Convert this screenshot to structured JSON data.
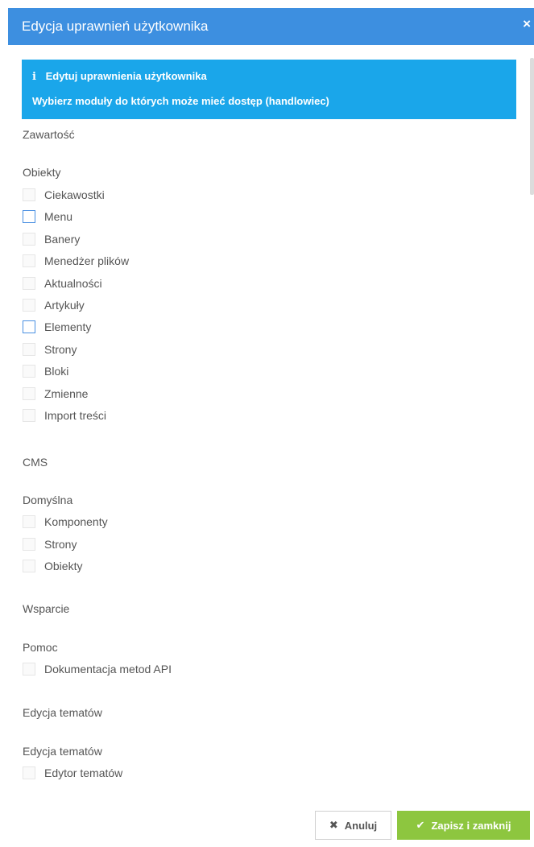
{
  "modal": {
    "title": "Edycja uprawnień użytkownika",
    "close_glyph": "×"
  },
  "info": {
    "icon": "i",
    "heading": "Edytuj uprawnienia użytkownika",
    "text_prefix": "Wybierz moduły do których może mieć dostęp ",
    "role": "(handlowiec)"
  },
  "sections": {
    "zawartosc": "Zawartość",
    "obiekty_group": "Obiekty",
    "cms": "CMS",
    "domyslna_group": "Domyślna",
    "wsparcie": "Wsparcie",
    "pomoc_group": "Pomoc",
    "edycja_section": "Edycja tematów",
    "edycja_group": "Edycja tematów"
  },
  "obiekty_items": [
    {
      "label": "Ciekawostki",
      "checked": false,
      "focused": false
    },
    {
      "label": "Menu",
      "checked": false,
      "focused": true
    },
    {
      "label": "Banery",
      "checked": false,
      "focused": false
    },
    {
      "label": "Menedżer plików",
      "checked": false,
      "focused": false
    },
    {
      "label": "Aktualności",
      "checked": false,
      "focused": false
    },
    {
      "label": "Artykuły",
      "checked": false,
      "focused": false
    },
    {
      "label": "Elementy",
      "checked": false,
      "focused": true
    },
    {
      "label": "Strony",
      "checked": false,
      "focused": false
    },
    {
      "label": "Bloki",
      "checked": false,
      "focused": false
    },
    {
      "label": "Zmienne",
      "checked": false,
      "focused": false
    },
    {
      "label": "Import treści",
      "checked": false,
      "focused": false
    }
  ],
  "domyslna_items": [
    {
      "label": "Komponenty",
      "checked": false,
      "focused": false
    },
    {
      "label": "Strony",
      "checked": false,
      "focused": false
    },
    {
      "label": "Obiekty",
      "checked": false,
      "focused": false
    }
  ],
  "pomoc_items": [
    {
      "label": "Dokumentacja metod API",
      "checked": false,
      "focused": false
    }
  ],
  "edycja_items": [
    {
      "label": "Edytor tematów",
      "checked": false,
      "focused": false
    }
  ],
  "buttons": {
    "cancel_icon": "✖",
    "cancel_label": "Anuluj",
    "save_icon": "✔",
    "save_label": "Zapisz i zamknij"
  },
  "colors": {
    "header": "#3d8fe0",
    "info_box": "#1aa6ea",
    "save_button": "#8dc63f",
    "checkbox_focus_border": "#4a90e2"
  }
}
